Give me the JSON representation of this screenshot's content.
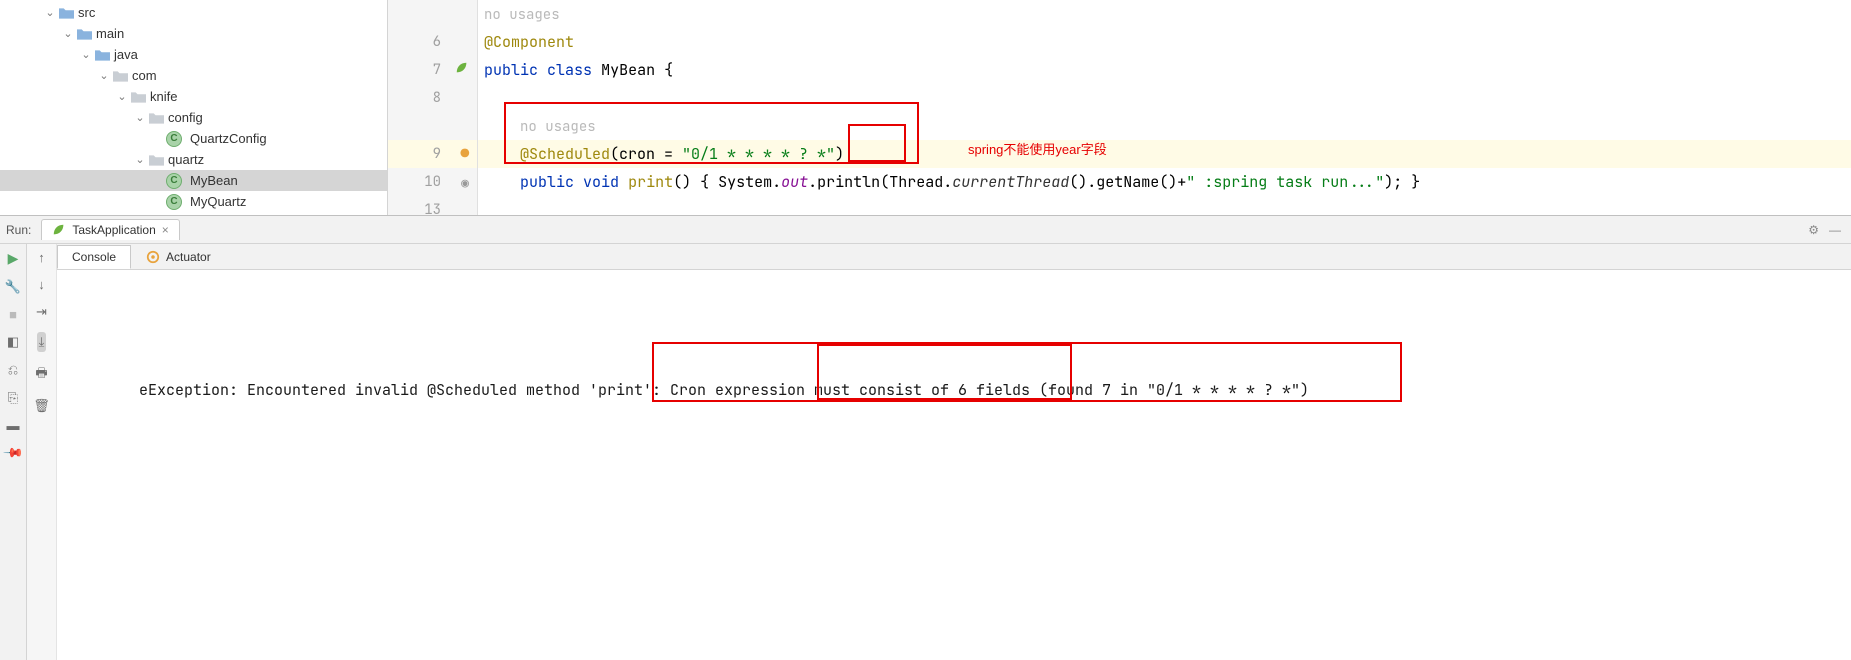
{
  "tree": {
    "src": "src",
    "main": "main",
    "java": "java",
    "com": "com",
    "knife": "knife",
    "config": "config",
    "quartzConfig": "QuartzConfig",
    "quartz": "quartz",
    "myBean": "MyBean",
    "myQuartz": "MyQuartz",
    "classLetter": "C"
  },
  "gutter": {
    "l6": "6",
    "l7": "7",
    "l8": "8",
    "l9": "9",
    "l10": "10",
    "l13": "13"
  },
  "code": {
    "noUsages1": "no usages",
    "component": "@Component",
    "public": "public",
    "class": "class",
    "myBean": "MyBean",
    "brace": " {",
    "noUsages2": "no usages",
    "scheduled": "@Scheduled",
    "cronParen": "(cron = ",
    "cronStr": "\"0/1 * * * * ? *\"",
    "closeParen": ")",
    "void": "void",
    "print": "print",
    "sig": "() { ",
    "system": "System",
    "dot1": ".",
    "out": "out",
    "dot2": ".",
    "println": "println",
    "thread": "(Thread.",
    "currentThread": "currentThread",
    "getname": "().getName()",
    "plus": "+",
    "msg": "\" :spring task run...\"",
    "end": "); }"
  },
  "annotation": "spring不能使用year字段",
  "run": {
    "title": "Run:",
    "appTab": "TaskApplication",
    "consoleTab": "Console",
    "actuatorTab": "Actuator",
    "error": "eException: Encountered invalid @Scheduled method 'print': Cron expression must consist of 6 fields (found 7 in \"0/1 * * * * ? *\")"
  }
}
